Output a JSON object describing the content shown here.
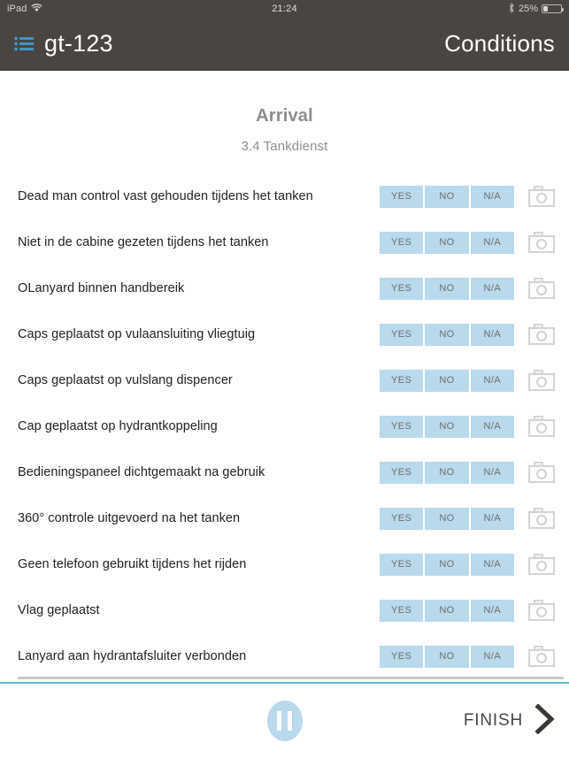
{
  "status_bar": {
    "device": "iPad",
    "wifi_icon": "wifi-icon",
    "time": "21:24",
    "bluetooth_icon": "bluetooth-icon",
    "battery_percent": "25%",
    "battery_level": 25
  },
  "navbar": {
    "menu_icon": "list-menu-icon",
    "vehicle": "gt-123",
    "title": "Conditions",
    "background": "#4a4543",
    "menu_icon_color": "#3f9fd4"
  },
  "form": {
    "title": "Arrival",
    "subtitle": "3.4 Tankdienst"
  },
  "answers": {
    "yes": "YES",
    "no": "NO",
    "na": "N/A",
    "button_color": "#b9d9ec",
    "camera_icon": "camera-icon"
  },
  "questions": [
    {
      "label": "Dead man control vast gehouden tijdens het tanken"
    },
    {
      "label": "Niet in de cabine gezeten tijdens het tanken"
    },
    {
      "label": "OLanyard binnen handbereik"
    },
    {
      "label": "Caps geplaatst op vulaansluiting vliegtuig"
    },
    {
      "label": "Caps geplaatst op vulslang dispencer"
    },
    {
      "label": "Cap geplaatst op hydrantkoppeling"
    },
    {
      "label": "Bedieningspaneel dichtgemaakt na gebruik"
    },
    {
      "label": "360° controle uitgevoerd na het tanken"
    },
    {
      "label": "Geen telefoon gebruikt tijdens het rijden"
    },
    {
      "label": "Vlag geplaatst"
    },
    {
      "label": "Lanyard aan hydrantafsluiter verbonden"
    }
  ],
  "bottom_bar": {
    "pause_icon": "pause-icon",
    "finish_label": "FINISH",
    "chevron_icon": "chevron-right-icon",
    "accent_color": "#5bb8d4"
  }
}
